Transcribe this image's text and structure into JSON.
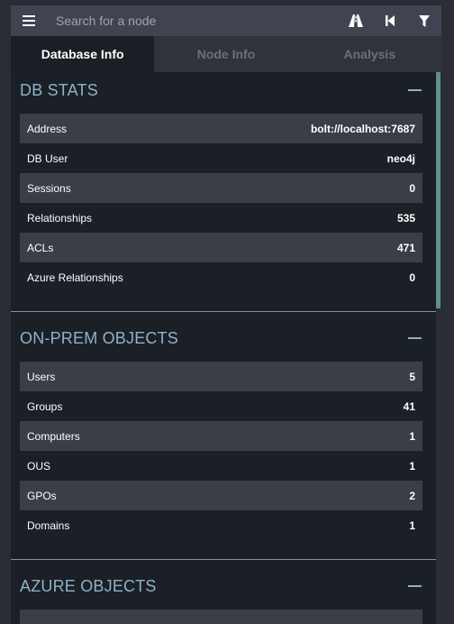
{
  "search": {
    "placeholder": "Search for a node",
    "value": ""
  },
  "toolbar": {
    "menu_icon": "menu-icon",
    "pathfinding_icon": "road-icon",
    "back_icon": "step-backward-icon",
    "filter_icon": "filter-icon"
  },
  "tabs": [
    {
      "label": "Database Info",
      "active": true
    },
    {
      "label": "Node Info",
      "active": false
    },
    {
      "label": "Analysis",
      "active": false
    }
  ],
  "sections": {
    "db_stats": {
      "title": "DB STATS",
      "rows": [
        {
          "label": "Address",
          "value": "bolt://localhost:7687"
        },
        {
          "label": "DB User",
          "value": "neo4j"
        },
        {
          "label": "Sessions",
          "value": "0"
        },
        {
          "label": "Relationships",
          "value": "535"
        },
        {
          "label": "ACLs",
          "value": "471"
        },
        {
          "label": "Azure Relationships",
          "value": "0"
        }
      ]
    },
    "on_prem": {
      "title": "ON-PREM OBJECTS",
      "rows": [
        {
          "label": "Users",
          "value": "5"
        },
        {
          "label": "Groups",
          "value": "41"
        },
        {
          "label": "Computers",
          "value": "1"
        },
        {
          "label": "OUS",
          "value": "1"
        },
        {
          "label": "GPOs",
          "value": "2"
        },
        {
          "label": "Domains",
          "value": "1"
        }
      ]
    },
    "azure": {
      "title": "AZURE OBJECTS"
    }
  },
  "colors": {
    "background": "#2a2d34",
    "panel": "#1b1f26",
    "row_stripe": "#3a3e47",
    "section_title": "#8fb2c9",
    "accent_scrollbar": "#5e8f8a"
  }
}
